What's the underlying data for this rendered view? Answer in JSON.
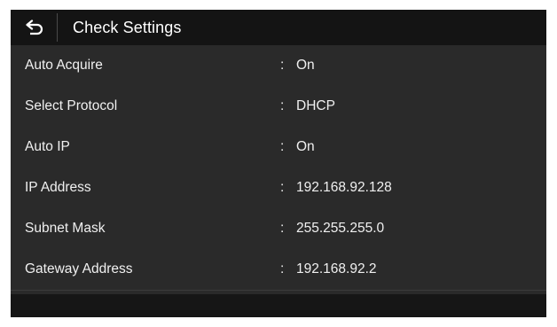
{
  "header": {
    "back_icon": "return-arrow-icon",
    "title": "Check Settings"
  },
  "settings": [
    {
      "label": "Auto Acquire",
      "colon": ":",
      "value": "On"
    },
    {
      "label": "Select Protocol",
      "colon": ":",
      "value": "DHCP"
    },
    {
      "label": "Auto IP",
      "colon": ":",
      "value": "On"
    },
    {
      "label": "IP Address",
      "colon": ":",
      "value": "192.168.92.128"
    },
    {
      "label": "Subnet Mask",
      "colon": ":",
      "value": "255.255.255.0"
    },
    {
      "label": "Gateway Address",
      "colon": ":",
      "value": "192.168.92.2"
    }
  ],
  "colors": {
    "background": "#2a2a2a",
    "header": "#141414",
    "text": "#f0f0f0"
  }
}
